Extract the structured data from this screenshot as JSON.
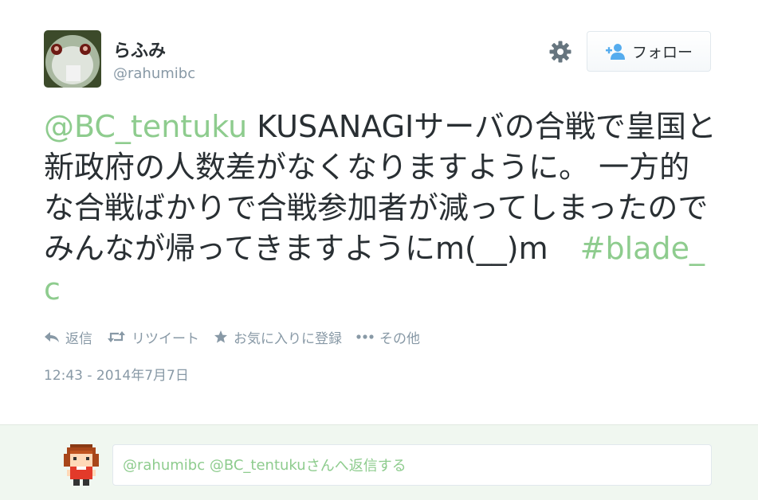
{
  "user": {
    "display_name": "らふみ",
    "handle": "@rahumibc"
  },
  "follow_button": {
    "label": "フォロー"
  },
  "tweet": {
    "mention": "@BC_tentuku",
    "text": " KUSANAGIサーバの合戦で皇国と新政府の人数差がなくなりますように。 一方的な合戦ばかりで合戦参加者が減ってしまったのでみんなが帰ってきますようにm(__)m",
    "hashtag": "#blade_c",
    "timestamp": "12:43 - 2014年7月7日"
  },
  "actions": {
    "reply": "返信",
    "retweet": "リツイート",
    "favorite": "お気に入りに登録",
    "more": "その他"
  },
  "reply_box": {
    "mentions": "@rahumibc @BC_tentuku",
    "suffix": "さんへ返信する"
  },
  "colors": {
    "link": "#8ecc8e",
    "muted": "#8899a6",
    "text": "#292f33",
    "reply_bg": "#f0f7f0"
  },
  "icons": [
    "gear-icon",
    "follow-person-plus-icon",
    "reply-icon",
    "retweet-icon",
    "favorite-star-icon",
    "more-dots-icon"
  ]
}
